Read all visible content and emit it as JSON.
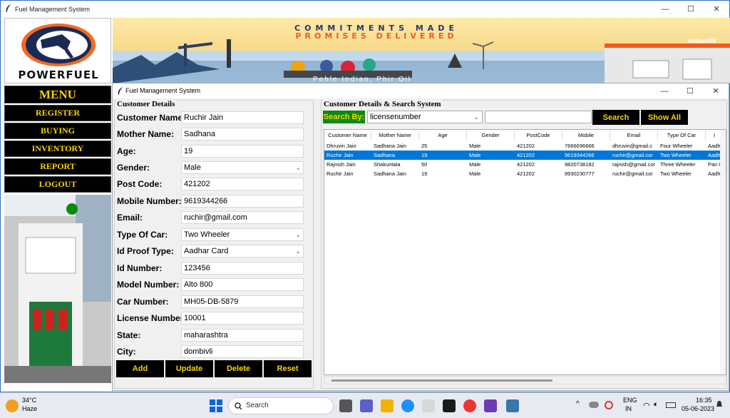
{
  "outer_window": {
    "title": "Fuel Management System",
    "controls": [
      "—",
      "☐",
      "✕"
    ]
  },
  "logo": {
    "brand": "POWERFUEL"
  },
  "banner": {
    "line1": "COMMITMENTS MADE",
    "line2": "PROMISES DELIVERED",
    "tagline": "Pehle Indian, Phir Oil",
    "brand": "IndianOil"
  },
  "menu": {
    "title": "MENU",
    "items": [
      "REGISTER",
      "BUYING",
      "INVENTORY",
      "REPORT",
      "LOGOUT"
    ]
  },
  "inner_window": {
    "title": "Fuel Management System",
    "controls": [
      "—",
      "☐",
      "✕"
    ]
  },
  "form": {
    "legend": "Customer Details",
    "fields": [
      {
        "label": "Customer Name:",
        "value": "Ruchir Jain"
      },
      {
        "label": "Mother Name:",
        "value": "Sadhana"
      },
      {
        "label": "Age:",
        "value": "19"
      },
      {
        "label": "Gender:",
        "value": "Male"
      },
      {
        "label": "Post Code:",
        "value": "421202"
      },
      {
        "label": "Mobile Number:",
        "value": "9619344266"
      },
      {
        "label": "Email:",
        "value": "ruchir@gmail.com"
      },
      {
        "label": "Type Of Car:",
        "value": "Two Wheeler"
      },
      {
        "label": "Id Proof Type:",
        "value": "Aadhar Card"
      },
      {
        "label": "Id Number:",
        "value": "123456"
      },
      {
        "label": "Model Number:",
        "value": "Alto 800"
      },
      {
        "label": "Car Number:",
        "value": "MH05-DB-5879"
      },
      {
        "label": "License Number:",
        "value": "10001"
      },
      {
        "label": "State:",
        "value": "maharashtra"
      },
      {
        "label": "City:",
        "value": "dombivli"
      }
    ],
    "buttons": {
      "add": "Add",
      "update": "Update",
      "delete": "Delete",
      "reset": "Reset"
    }
  },
  "search": {
    "legend": "Customer Details & Search System",
    "search_by_label": "Search By:",
    "search_by_value": "licensenumber",
    "search_input": "",
    "search_button": "Search",
    "show_all_button": "Show All"
  },
  "table": {
    "columns": [
      "Customer Name",
      "Mother Name",
      "Age",
      "Gender",
      "PostCode",
      "Mobile",
      "Email",
      "Type Of Car",
      "I"
    ],
    "rows": [
      [
        "Dhruvin Jain",
        "Sadhana Jain",
        "25",
        "Male",
        "421202",
        "7666696666",
        "dhruvin@gmail.c",
        "Four Wheeler",
        "Aadh"
      ],
      [
        "Ruchir Jain",
        "Sadhana",
        "19",
        "Male",
        "421202",
        "9619344266",
        "ruchir@gmail.cor",
        "Two Wheeler",
        "Aadh"
      ],
      [
        "Rajnish Jain",
        "Shakuntala",
        "50",
        "Male",
        "421202",
        "9820738182",
        "rajnish@gmail.cor",
        "Three Wheeler",
        "Pan C"
      ],
      [
        "Ruchir Jain",
        "Sadhana Jain",
        "19",
        "Male",
        "421202",
        "9930230777",
        "ruchir@gmail.cor",
        "Two Wheeler",
        "Aadh"
      ]
    ],
    "selected_row": 1
  },
  "taskbar": {
    "weather_temp": "34°C",
    "weather_desc": "Haze",
    "search_label": "Search",
    "lang_top": "ENG",
    "lang_bottom": "IN",
    "time": "16:35",
    "date": "05-06-2023"
  },
  "colors": {
    "accent_yellow": "#f5d400",
    "button_black": "#000000",
    "search_green": "#0a8a0a",
    "selection_blue": "#0078d7"
  }
}
